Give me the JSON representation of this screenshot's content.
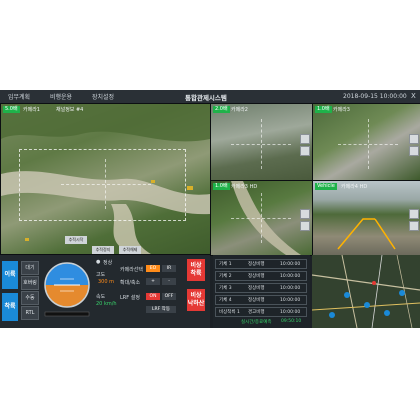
{
  "menu": {
    "items": [
      "임무계획",
      "비행운용",
      "장치설정"
    ],
    "title": "통합관제시스템",
    "datetime": "2018-09-15 10:00:00",
    "close": "X"
  },
  "videos": {
    "main": {
      "tag": "5.0배",
      "name": "카메라1",
      "label": "채널정보 #4"
    },
    "top_mid": {
      "tag": "2.0배",
      "name": "카메라2"
    },
    "top_right": {
      "tag": "1.0배",
      "name": "카메라3"
    },
    "bottom_mid": {
      "tag": "1.0배",
      "name": "카메라3 HD"
    },
    "bottom_right": {
      "tag": "Vehicle",
      "name": "카메라4 HD"
    }
  },
  "main_overlay_buttons": [
    "추적시작",
    "추적정지",
    "추적해제"
  ],
  "control": {
    "mode_buttons": [
      "이륙",
      "착륙"
    ],
    "small_buttons": [
      "대기",
      "호버링",
      "수동",
      "RTL"
    ],
    "status_label": "정상",
    "altitude_label": "고도",
    "altitude_value": "300 m",
    "speed_label": "속도",
    "speed_value": "20 km/h",
    "camera_switch_label": "카메라선택",
    "camera_options": [
      "EO",
      "IR"
    ],
    "zoom_label": "확대/축소",
    "zoom_options": [
      "+",
      "-"
    ],
    "lrf_label": "LRF 설정",
    "lrf_options": [
      "ON",
      "OFF"
    ],
    "lrf_action": "LRF 작동",
    "emergency_takeoff": "비상 착륙",
    "emergency_return": "비상 낙하산"
  },
  "log": {
    "rows": [
      {
        "name": "기체 1",
        "status": "정상비행",
        "time": "10:00:00"
      },
      {
        "name": "기체 2",
        "status": "정상비행",
        "time": "10:00:00"
      },
      {
        "name": "기체 3",
        "status": "정상비행",
        "time": "10:00:00"
      },
      {
        "name": "기체 4",
        "status": "정상비행",
        "time": "10:00:00"
      },
      {
        "name": "비상착륙 1",
        "status": "경고비행",
        "time": "10:00:00"
      }
    ],
    "footer_label": "실시간/종료예측",
    "footer_time": "09:50:10"
  },
  "colors": {
    "accent": "#1a8ad8",
    "ok": "#1fb24a",
    "warn": "#ff8c1a",
    "danger": "#e53935",
    "bg": "#1c2126"
  }
}
